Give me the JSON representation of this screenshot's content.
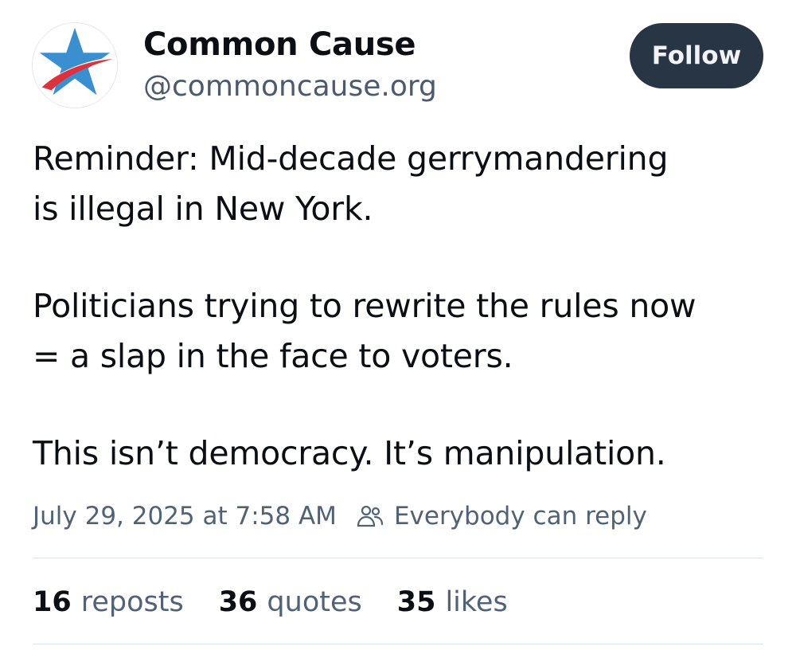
{
  "author": {
    "display_name": "Common Cause",
    "handle": "@commoncause.org",
    "avatar_icon": "common-cause-star-logo",
    "avatar_colors": {
      "star": "#3a8fd0",
      "swoosh": "#e0303c"
    }
  },
  "follow_button": {
    "label": "Follow",
    "color": "#283544"
  },
  "post": {
    "lines": [
      "Reminder: Mid-decade gerrymandering",
      "is illegal in New York.",
      "Politicians trying to rewrite the rules now",
      "= a slap in the face to voters.",
      "This isn’t democracy. It’s manipulation."
    ]
  },
  "meta": {
    "timestamp": "July 29, 2025 at 7:58 AM",
    "reply_icon": "people-icon",
    "reply_setting": "Everybody can reply"
  },
  "stats": {
    "reposts": {
      "count": "16",
      "label": "reposts"
    },
    "quotes": {
      "count": "36",
      "label": "quotes"
    },
    "likes": {
      "count": "35",
      "label": "likes"
    }
  }
}
